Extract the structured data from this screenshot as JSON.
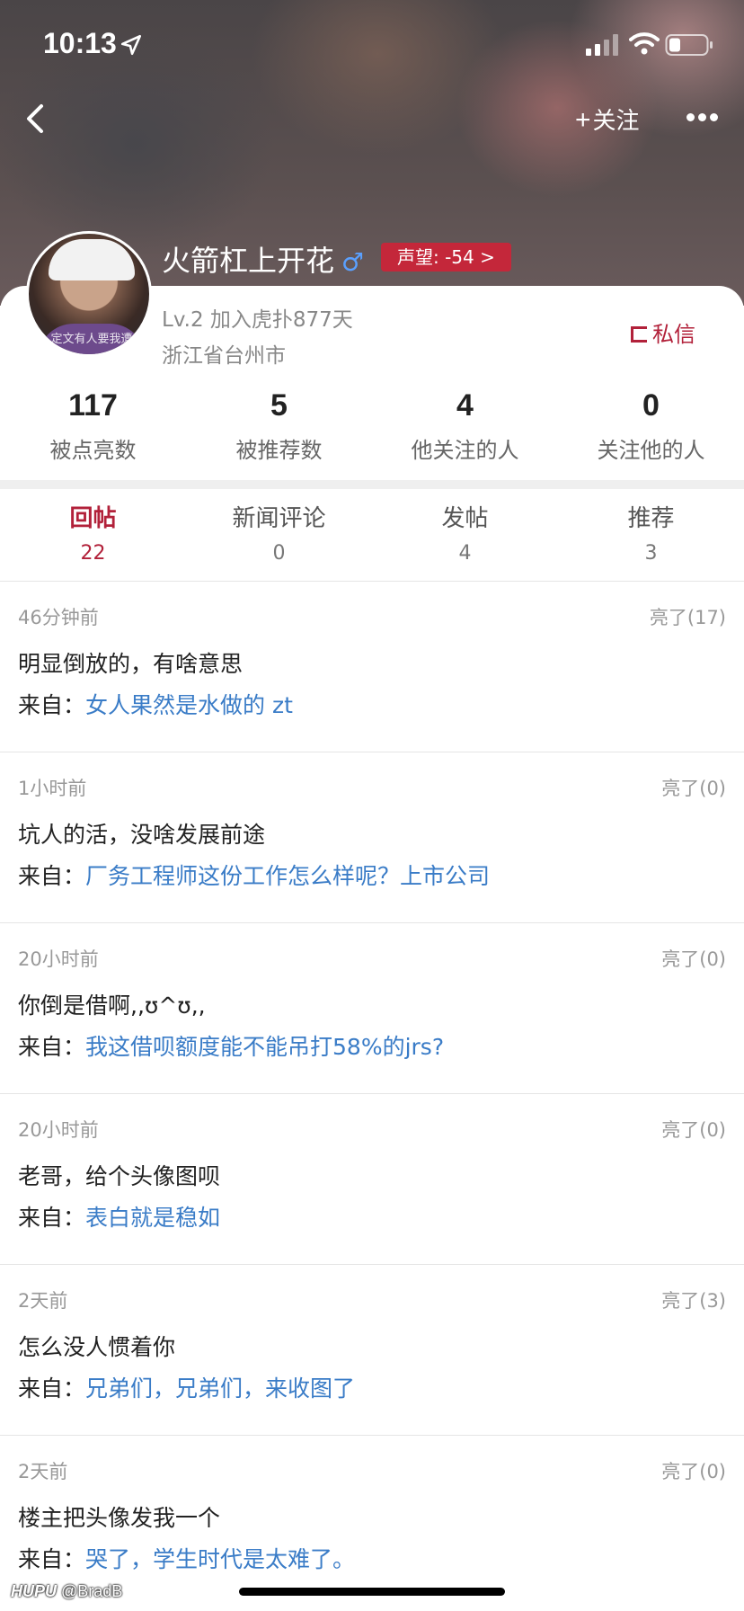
{
  "status_bar": {
    "time": "10:13"
  },
  "nav": {
    "follow_label": "关注",
    "follow_plus": "+"
  },
  "profile": {
    "username": "火箭杠上开花",
    "gender_symbol": "♂",
    "reputation": "声望: -54 >",
    "level": "Lv.2 加入虎扑877天",
    "location": "浙江省台州市",
    "private_message": "私信",
    "avatar_caption": "定文有人要我遭"
  },
  "stats": [
    {
      "value": "117",
      "label": "被点亮数"
    },
    {
      "value": "5",
      "label": "被推荐数"
    },
    {
      "value": "4",
      "label": "他关注的人"
    },
    {
      "value": "0",
      "label": "关注他的人"
    }
  ],
  "tabs": [
    {
      "label": "回帖",
      "count": "22"
    },
    {
      "label": "新闻评论",
      "count": "0"
    },
    {
      "label": "发帖",
      "count": "4"
    },
    {
      "label": "推荐",
      "count": "3"
    }
  ],
  "posts": [
    {
      "time": "46分钟前",
      "likes": "亮了(17)",
      "text": "明显倒放的，有啥意思",
      "source_prefix": "来自：",
      "source": "女人果然是水做的 zt"
    },
    {
      "time": "1小时前",
      "likes": "亮了(0)",
      "text": "坑人的活，没啥发展前途",
      "source_prefix": "来自：",
      "source": "厂务工程师这份工作怎么样呢？上市公司"
    },
    {
      "time": "20小时前",
      "likes": "亮了(0)",
      "text": "你倒是借啊,,ʊ^ʊ,,",
      "source_prefix": "来自：",
      "source": "我这借呗额度能不能吊打58%的jrs?"
    },
    {
      "time": "20小时前",
      "likes": "亮了(0)",
      "text": "老哥，给个头像图呗",
      "source_prefix": "来自：",
      "source": "表白就是稳如"
    },
    {
      "time": "2天前",
      "likes": "亮了(3)",
      "text": "怎么没人惯着你",
      "source_prefix": "来自：",
      "source": "兄弟们，兄弟们，来收图了"
    },
    {
      "time": "2天前",
      "likes": "亮了(0)",
      "text": "楼主把头像发我一个",
      "source_prefix": "来自：",
      "source": "哭了，学生时代是太难了。"
    }
  ],
  "watermark": {
    "brand": "HUPU",
    "handle": "@BradB"
  },
  "colors": {
    "accent": "#b2213a",
    "link": "#3a7cc7",
    "badge": "#c4273a"
  }
}
